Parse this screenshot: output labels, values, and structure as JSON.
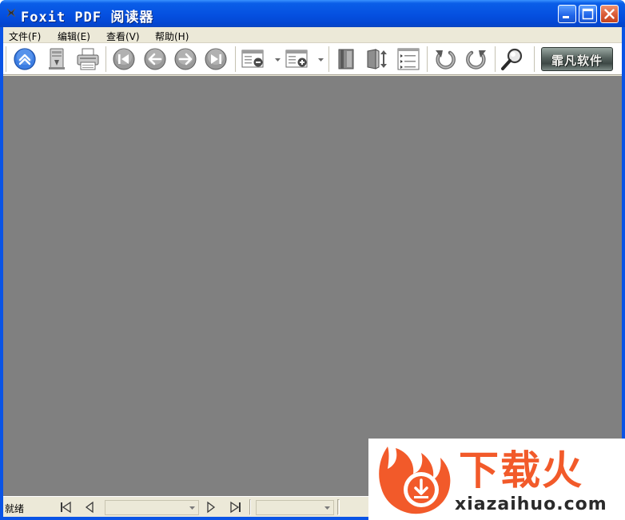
{
  "window": {
    "title": "Foxit PDF 阅读器",
    "colors": {
      "titlebar": "#0550e0",
      "client": "#ece9d8",
      "document": "#808080"
    }
  },
  "menu": {
    "items": [
      {
        "label": "文件(F)"
      },
      {
        "label": "编辑(E)"
      },
      {
        "label": "查看(V)"
      },
      {
        "label": "帮助(H)"
      }
    ]
  },
  "toolbar": {
    "buttons": [
      "up-icon",
      "download-icon",
      "print-icon",
      "first-page-icon",
      "previous-page-icon",
      "next-page-icon",
      "last-page-icon",
      "zoom-out-icon",
      "zoom-in-icon",
      "bookmark-icon",
      "fit-page-icon",
      "thumbnails-icon",
      "rotate-left-icon",
      "rotate-right-icon",
      "magnifier-icon"
    ],
    "logo_text": "霏凡软件"
  },
  "status": {
    "text": "就绪",
    "page_value": "",
    "zoom_value": ""
  },
  "watermark": {
    "brand": "下载火",
    "url": "xiazaihuo.com",
    "color": "#f25a2a"
  }
}
